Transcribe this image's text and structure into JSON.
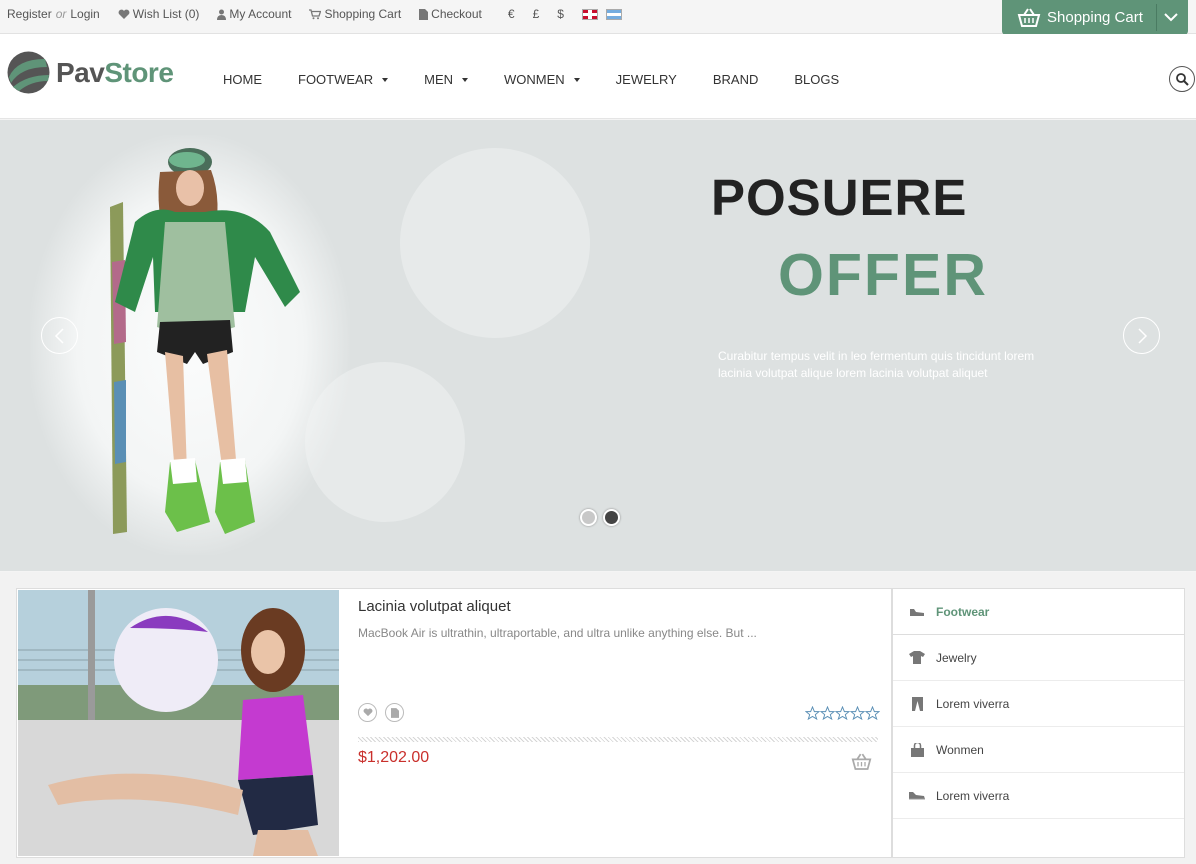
{
  "topbar": {
    "register": "Register",
    "or": "or",
    "login": "Login",
    "wishlist": "Wish List (0)",
    "account": "My Account",
    "cart": "Shopping Cart",
    "checkout": "Checkout",
    "currencies": [
      "€",
      "£",
      "$"
    ]
  },
  "cart_button": {
    "label": "Shopping Cart"
  },
  "logo": {
    "pav": "Pav",
    "store": "Store"
  },
  "nav": [
    {
      "label": "HOME",
      "dropdown": false
    },
    {
      "label": "FOOTWEAR",
      "dropdown": true
    },
    {
      "label": "MEN",
      "dropdown": true
    },
    {
      "label": "WONMEN",
      "dropdown": true
    },
    {
      "label": "JEWELRY",
      "dropdown": false
    },
    {
      "label": "BRAND",
      "dropdown": false
    },
    {
      "label": "BLOGS",
      "dropdown": false
    }
  ],
  "slider": {
    "title": "POSUERE",
    "subtitle": "OFFER",
    "description": "Curabitur tempus velit in leo fermentum quis tincidunt lorem lacinia volutpat alique lorem lacinia volutpat aliquet",
    "active_slide": 2,
    "slide_count": 2
  },
  "product": {
    "name": "Lacinia volutpat aliquet",
    "description": "MacBook Air is ultrathin, ultraportable, and ultra unlike anything else. But ...",
    "price": "$1,202.00",
    "rating": 0,
    "max_rating": 5
  },
  "categories": [
    {
      "label": "Footwear",
      "icon": "shoe-icon",
      "active": true
    },
    {
      "label": "Jewelry",
      "icon": "tshirt-icon",
      "active": false
    },
    {
      "label": "Lorem viverra",
      "icon": "pants-icon",
      "active": false
    },
    {
      "label": "Wonmen",
      "icon": "bag-icon",
      "active": false
    },
    {
      "label": "Lorem viverra",
      "icon": "sneaker-icon",
      "active": false
    }
  ],
  "colors": {
    "accent": "#5f9478",
    "price": "#c9302c",
    "slider_bg": "#dde1e1"
  }
}
